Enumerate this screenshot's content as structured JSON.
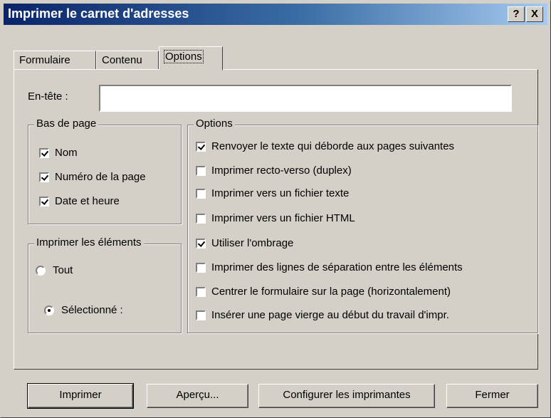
{
  "window": {
    "title": "Imprimer le carnet d'adresses"
  },
  "titlebar_buttons": {
    "help": "?",
    "close": "X"
  },
  "tabs": [
    {
      "label": "Formulaire",
      "active": false
    },
    {
      "label": "Contenu",
      "active": false
    },
    {
      "label": "Options",
      "active": true
    }
  ],
  "header_field": {
    "label": "En-tête :",
    "value": ""
  },
  "footer_group": {
    "legend": "Bas de page",
    "items": [
      {
        "label": "Nom",
        "checked": true
      },
      {
        "label": "Numéro de la page",
        "checked": true
      },
      {
        "label": "Date et heure",
        "checked": true
      }
    ]
  },
  "print_items_group": {
    "legend": "Imprimer les éléments",
    "options": [
      {
        "label": "Tout",
        "selected": false
      },
      {
        "label": "Sélectionné :",
        "selected": true
      }
    ]
  },
  "options_group": {
    "legend": "Options",
    "items": [
      {
        "label": "Renvoyer le texte qui déborde aux pages suivantes",
        "checked": true
      },
      {
        "label": "Imprimer recto-verso (duplex)",
        "checked": false
      },
      {
        "label": "Imprimer vers un fichier texte",
        "checked": false
      },
      {
        "label": "Imprimer vers un fichier HTML",
        "checked": false
      },
      {
        "label": "Utiliser l'ombrage",
        "checked": true
      },
      {
        "label": "Imprimer des lignes de séparation entre les éléments",
        "checked": false
      },
      {
        "label": "Centrer le formulaire sur la page (horizontalement)",
        "checked": false
      },
      {
        "label": "Insérer une page vierge au début du travail d'impr.",
        "checked": false
      }
    ]
  },
  "buttons": {
    "print": "Imprimer",
    "preview": "Aperçu...",
    "configure": "Configurer les imprimantes",
    "close": "Fermer"
  }
}
